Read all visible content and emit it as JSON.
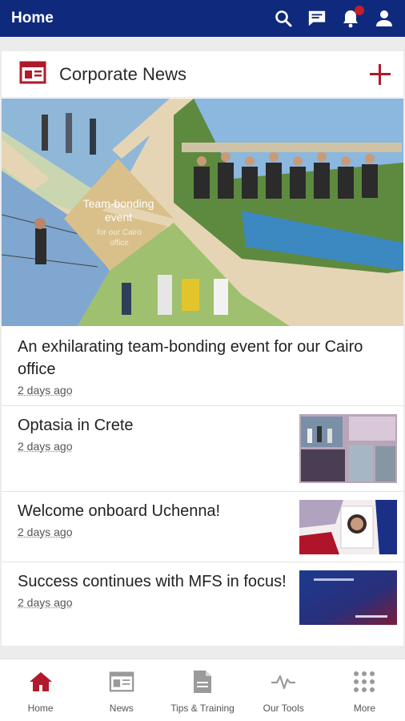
{
  "appbar": {
    "title": "Home"
  },
  "section": {
    "title": "Corporate News"
  },
  "hero": {
    "overlay_title": "Team-bonding event",
    "overlay_sub": "for our Cairo office"
  },
  "news": [
    {
      "title": "An exhilarating team-bonding event for our Cairo office",
      "date": "2 days ago"
    },
    {
      "title": "Optasia in Crete",
      "date": "2 days ago"
    },
    {
      "title": "Welcome onboard Uchenna!",
      "date": "2 days ago"
    },
    {
      "title": "Success continues with MFS in focus!",
      "date": "2 days ago"
    }
  ],
  "nav": [
    {
      "label": "Home",
      "icon": "home-icon"
    },
    {
      "label": "News",
      "icon": "news-icon"
    },
    {
      "label": "Tips & Training",
      "icon": "document-icon"
    },
    {
      "label": "Our Tools",
      "icon": "pulse-icon"
    },
    {
      "label": "More",
      "icon": "grid-icon"
    }
  ],
  "colors": {
    "primary": "#0f2a7c",
    "accent": "#b01a2a",
    "inactive": "#9a9a9a"
  }
}
